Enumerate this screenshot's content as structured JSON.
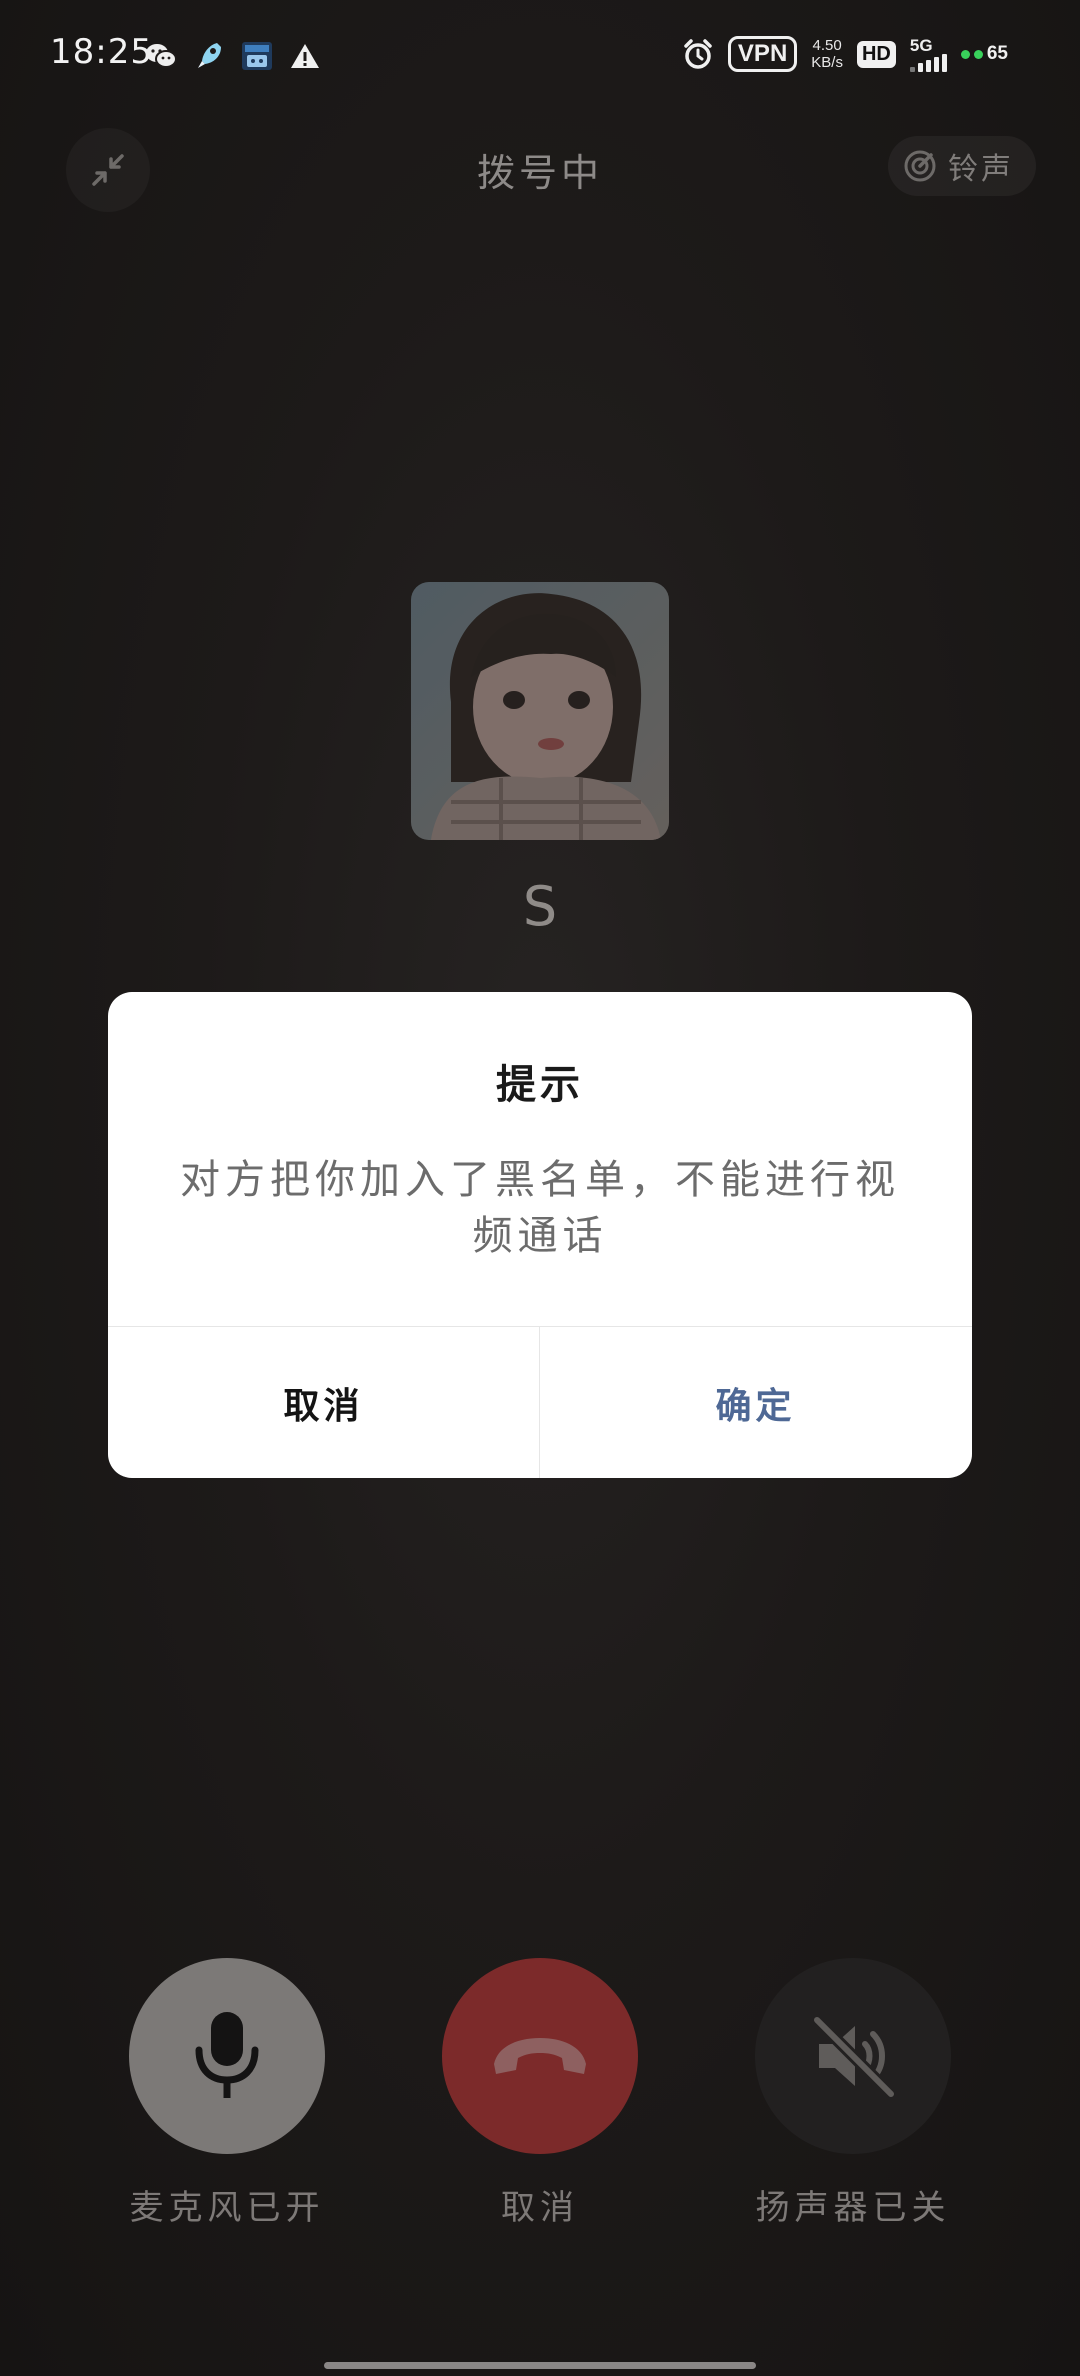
{
  "status_bar": {
    "time": "18:25",
    "notification_icons": [
      "wechat-icon",
      "rocket-icon",
      "bilibili-icon",
      "warning-icon"
    ],
    "vpn": "VPN",
    "net_speed_value": "4.50",
    "net_speed_unit": "KB/s",
    "hd": "HD",
    "network": "5G",
    "battery": "65",
    "colors": {
      "battery_dot": "#39d15b"
    }
  },
  "top_bar": {
    "status": "拨号中",
    "ringtone_label": "铃声"
  },
  "contact": {
    "name": "S"
  },
  "dialog": {
    "title": "提示",
    "message": "对方把你加入了黑名单，不能进行视频通话",
    "cancel_label": "取消",
    "confirm_label": "确定",
    "colors": {
      "confirm": "#4e6895"
    }
  },
  "controls": {
    "mic_label": "麦克风已开",
    "hangup_label": "取消",
    "speaker_label": "扬声器已关",
    "colors": {
      "hangup": "#7c2a2a"
    }
  }
}
